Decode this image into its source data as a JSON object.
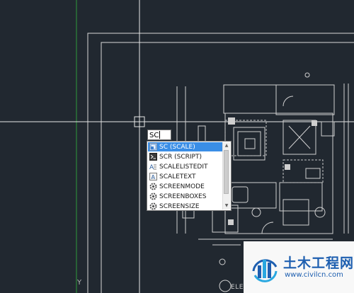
{
  "command_line": {
    "input_value": "SC"
  },
  "autocomplete": {
    "items": [
      {
        "label": "SC (SCALE)",
        "icon": "scale-icon",
        "selected": true
      },
      {
        "label": "SCR (SCRIPT)",
        "icon": "script-icon",
        "selected": false
      },
      {
        "label": "SCALELISTEDIT",
        "icon": "scale-list-edit-icon",
        "selected": false
      },
      {
        "label": "SCALETEXT",
        "icon": "scale-text-icon",
        "selected": false
      },
      {
        "label": "SCREENMODE",
        "icon": "gear-icon",
        "selected": false
      },
      {
        "label": "SCREENBOXES",
        "icon": "gear-icon",
        "selected": false
      },
      {
        "label": "SCREENSIZE",
        "icon": "gear-icon",
        "selected": false
      }
    ]
  },
  "canvas": {
    "background": "#212830",
    "line_color": "#e8e8e8",
    "ucs_axis_label": "Y",
    "elevation_label": "ELE"
  },
  "watermark": {
    "site_name": "土木工程网",
    "url": "www.civilcn.com",
    "color": "#1e5fb0"
  }
}
